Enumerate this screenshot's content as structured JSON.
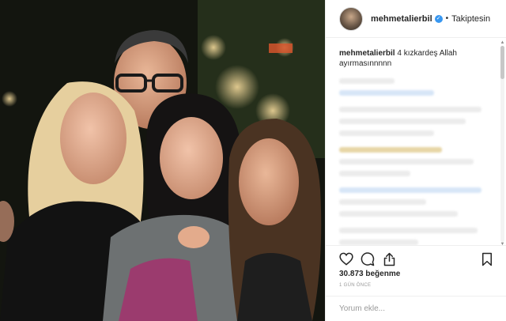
{
  "post": {
    "username": "mehmetalierbil",
    "follow_status": "Takiptesin",
    "separator": "•",
    "caption_text": "4 kızkardeş Allah ayırmasınnnnn",
    "likes": "30.873 beğenme",
    "time_ago": "1 GÜN ÖNCE",
    "comment_placeholder": "Yorum ekle..."
  },
  "icons": {
    "verified": "verified-badge-icon",
    "like": "heart-icon",
    "comment": "speech-bubble-icon",
    "share": "share-arrow-icon",
    "save": "bookmark-icon"
  },
  "colors": {
    "verified_blue": "#3897f0",
    "text": "#262626",
    "muted": "#999999",
    "divider": "#efefef"
  }
}
